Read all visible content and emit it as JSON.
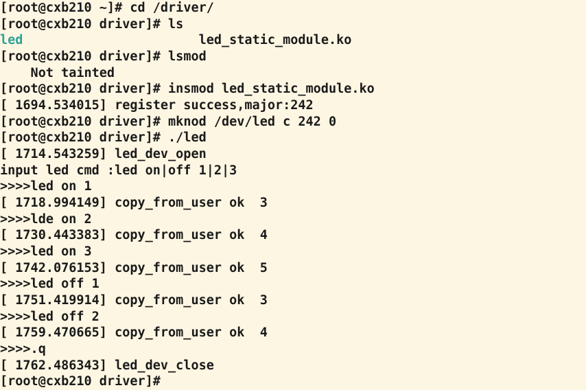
{
  "lines": [
    {
      "prompt": "[root@cxb210 ~]# ",
      "cmd": "cd /driver/"
    },
    {
      "prompt": "[root@cxb210 driver]# ",
      "cmd": "ls"
    },
    {
      "ls_teal": "led",
      "ls_space": "                       ",
      "ls_file": "led_static_module.ko"
    },
    {
      "prompt": "[root@cxb210 driver]# ",
      "cmd": "lsmod"
    },
    {
      "text": "    Not tainted"
    },
    {
      "prompt": "[root@cxb210 driver]# ",
      "cmd": "insmod led_static_module.ko"
    },
    {
      "text": "[ 1694.534015] register success,major:242"
    },
    {
      "prompt": "[root@cxb210 driver]# ",
      "cmd": "mknod /dev/led c 242 0"
    },
    {
      "prompt": "[root@cxb210 driver]# ",
      "cmd": "./led"
    },
    {
      "text": "[ 1714.543259] led_dev_open"
    },
    {
      "text": "input led cmd :led on|off 1|2|3"
    },
    {
      "text": ">>>>led on 1"
    },
    {
      "text": "[ 1718.994149] copy_from_user ok  3"
    },
    {
      "text": ">>>>lde on 2"
    },
    {
      "text": "[ 1730.443383] copy_from_user ok  4"
    },
    {
      "text": ">>>>led on 3"
    },
    {
      "text": "[ 1742.076153] copy_from_user ok  5"
    },
    {
      "text": ">>>>led off 1"
    },
    {
      "text": "[ 1751.419914] copy_from_user ok  3"
    },
    {
      "text": ">>>>led off 2"
    },
    {
      "text": "[ 1759.470665] copy_from_user ok  4"
    },
    {
      "text": ">>>>.q"
    },
    {
      "text": "[ 1762.486343] led_dev_close"
    },
    {
      "prompt": "[root@cxb210 driver]# ",
      "cmd": ""
    }
  ]
}
